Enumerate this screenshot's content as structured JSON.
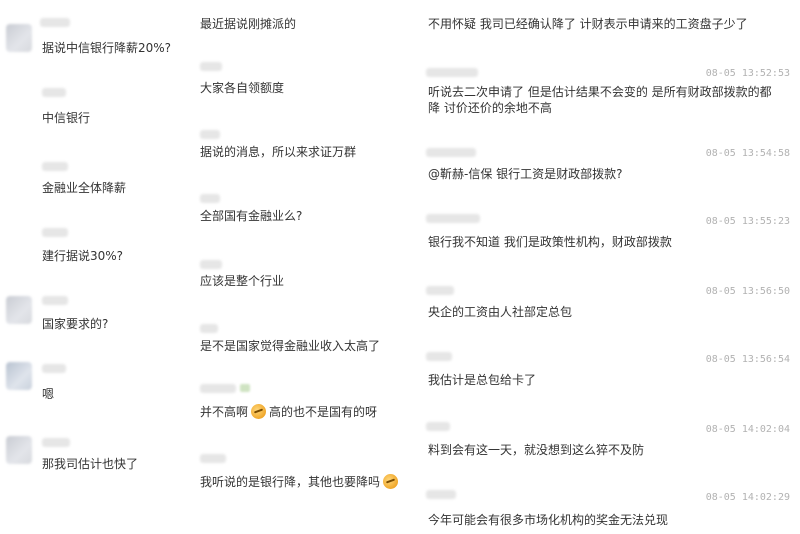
{
  "col1": {
    "messages": [
      {
        "text": "据说中信银行降薪20%?"
      },
      {
        "text": "中信银行"
      },
      {
        "text": "金融业全体降薪"
      },
      {
        "text": "建行据说30%?"
      },
      {
        "text": "国家要求的?"
      },
      {
        "text": "嗯"
      },
      {
        "text": "那我司估计也快了"
      }
    ]
  },
  "col2": {
    "messages": [
      {
        "text": "最近据说刚摊派的"
      },
      {
        "text": "大家各自领额度"
      },
      {
        "text": "据说的消息，所以来求证万群"
      },
      {
        "text": "全部国有金融业么?"
      },
      {
        "text": "应该是整个行业"
      },
      {
        "text": "是不是国家觉得金融业收入太高了"
      },
      {
        "text_before": "并不高啊",
        "emoji": "facepalm-emoji",
        "text_after": "高的也不是国有的呀"
      },
      {
        "text_before": "我听说的是银行降，其他也要降吗",
        "emoji": "facepalm-emoji"
      }
    ]
  },
  "col3": {
    "messages": [
      {
        "text": "不用怀疑 我司已经确认降了 计财表示申请来的工资盘子少了",
        "time": ""
      },
      {
        "text": "听说去二次申请了 但是估计结果不会变的 是所有财政部拨款的都降 讨价还价的余地不高",
        "time": "08-05 13:52:53"
      },
      {
        "text": "@靳赫-信保 银行工资是财政部拨款?",
        "time": "08-05 13:54:58"
      },
      {
        "text": "银行我不知道 我们是政策性机构，财政部拨款",
        "time": "08-05 13:55:23"
      },
      {
        "text": "央企的工资由人社部定总包",
        "time": "08-05 13:56:50"
      },
      {
        "text": "我估计是总包给卡了",
        "time": "08-05 13:56:54"
      },
      {
        "text": "料到会有这一天，就没想到这么猝不及防",
        "time": "08-05 14:02:04"
      },
      {
        "text": "今年可能会有很多市场化机构的奖金无法兑现",
        "time": "08-05 14:02:29"
      }
    ]
  }
}
